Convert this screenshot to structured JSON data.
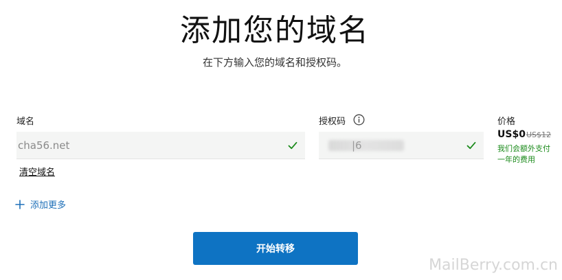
{
  "header": {
    "title": "添加您的域名",
    "subtitle": "在下方输入您的域名和授权码。"
  },
  "form": {
    "domain_label": "域名",
    "domain_value": "cha56.net",
    "auth_label": "授权码",
    "auth_value": "|6",
    "clear_label": "清空域名",
    "add_more_label": "添加更多",
    "submit_label": "开始转移"
  },
  "price": {
    "label": "价格",
    "current": "US$0",
    "original": "US$12",
    "note": "我们会额外支付一年的费用"
  },
  "icons": {
    "info": "info-icon",
    "check": "check-icon",
    "plus": "plus-icon"
  },
  "colors": {
    "accent": "#0e73c3",
    "success": "#1a8a1a",
    "link": "#1d6fb8"
  },
  "watermark": "MailBerry.com.cn"
}
